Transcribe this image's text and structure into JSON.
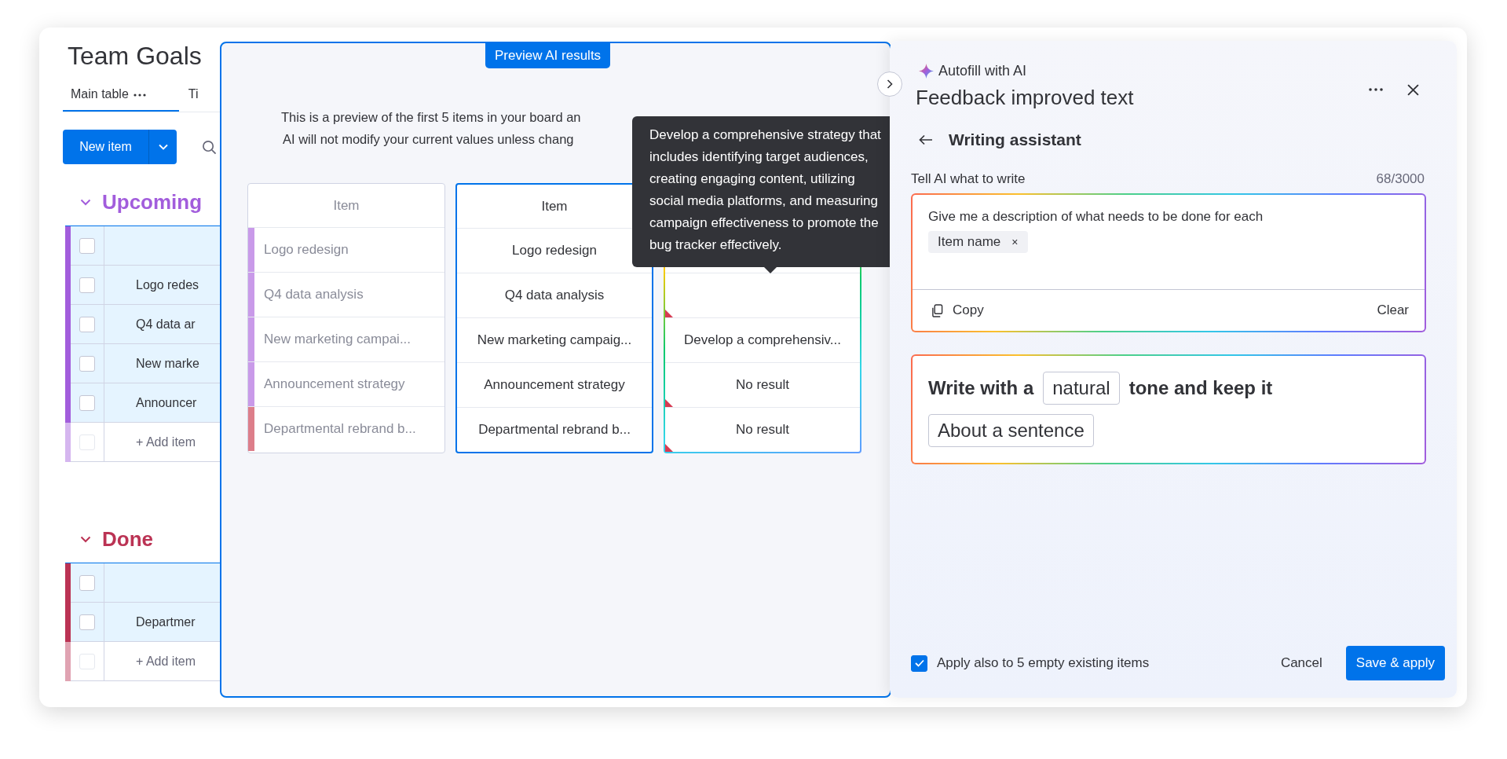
{
  "board": {
    "title": "Team Goals",
    "tabs": [
      {
        "label": "Main table",
        "selected": true
      },
      {
        "label": "Ti",
        "selected": false
      }
    ],
    "new_item_button": "New item",
    "groups": [
      {
        "name": "Upcoming",
        "color": "#a25ddc",
        "all_checked": false,
        "rows": [
          {
            "name": "Logo redes",
            "checked": false
          },
          {
            "name": "Q4 data ar",
            "checked": false
          },
          {
            "name": "New marke",
            "checked": false
          },
          {
            "name": "Announcer",
            "checked": false
          }
        ],
        "add_item": "+ Add item",
        "add_row_checkbox_disabled": true
      },
      {
        "name": "Done",
        "color": "#bb3354",
        "all_checked": false,
        "rows": [
          {
            "name": "Departmer",
            "checked": false
          }
        ],
        "add_item": "+ Add item",
        "add_row_checkbox_disabled": true
      }
    ]
  },
  "preview": {
    "badge": "Preview AI results",
    "description": [
      "This is a preview of the first 5 items in your board an",
      "AI will not modify your current values unless chang"
    ],
    "columns": [
      {
        "kind": "source",
        "header": "Item",
        "rows": [
          {
            "text": "Logo redesign",
            "color": "#c99ae9"
          },
          {
            "text": "Q4 data analysis",
            "color": "#c99ae9"
          },
          {
            "text": "New marketing campai...",
            "color": "#c99ae9"
          },
          {
            "text": "Announcement strategy",
            "color": "#c99ae9"
          },
          {
            "text": "Departmental rebrand b...",
            "color": "#dd7e8a"
          }
        ]
      },
      {
        "kind": "item",
        "header": "Item",
        "rows": [
          {
            "text": "Logo redesign"
          },
          {
            "text": "Q4 data analysis"
          },
          {
            "text": "New marketing campaig..."
          },
          {
            "text": "Announcement strategy"
          },
          {
            "text": "Departmental rebrand b..."
          }
        ]
      },
      {
        "kind": "result",
        "rows": [
          {
            "flagged": true
          },
          {
            "text": "Develop a comprehensiv...",
            "flagged": false
          },
          {
            "text": "No result",
            "flagged": true
          },
          {
            "text": "No result",
            "flagged": true
          }
        ]
      }
    ],
    "tooltip": "Develop a comprehensive strategy that includes identifying target audiences, creating engaging content, utilizing social media platforms, and measuring campaign effectiveness to promote the bug tracker effectively."
  },
  "panel": {
    "eyebrow": "Autofill with AI",
    "title": "Feedback improved text",
    "section": "Writing assistant",
    "prompt": {
      "label": "Tell AI what to write",
      "counter": "68/3000",
      "text": "Give me a description of what needs to be done for each",
      "chip": "Item name",
      "chip_remove": "×",
      "copy": "Copy",
      "clear": "Clear"
    },
    "style_sentence": [
      {
        "kind": "text",
        "text": "Write with a"
      },
      {
        "kind": "choice",
        "text": "natural"
      },
      {
        "kind": "text",
        "text": "tone and keep it"
      },
      {
        "kind": "choice",
        "text": "About a sentence"
      }
    ],
    "apply_existing": {
      "label": "Apply also to 5 empty existing items",
      "checked": true
    },
    "cancel": "Cancel",
    "save": "Save & apply"
  }
}
